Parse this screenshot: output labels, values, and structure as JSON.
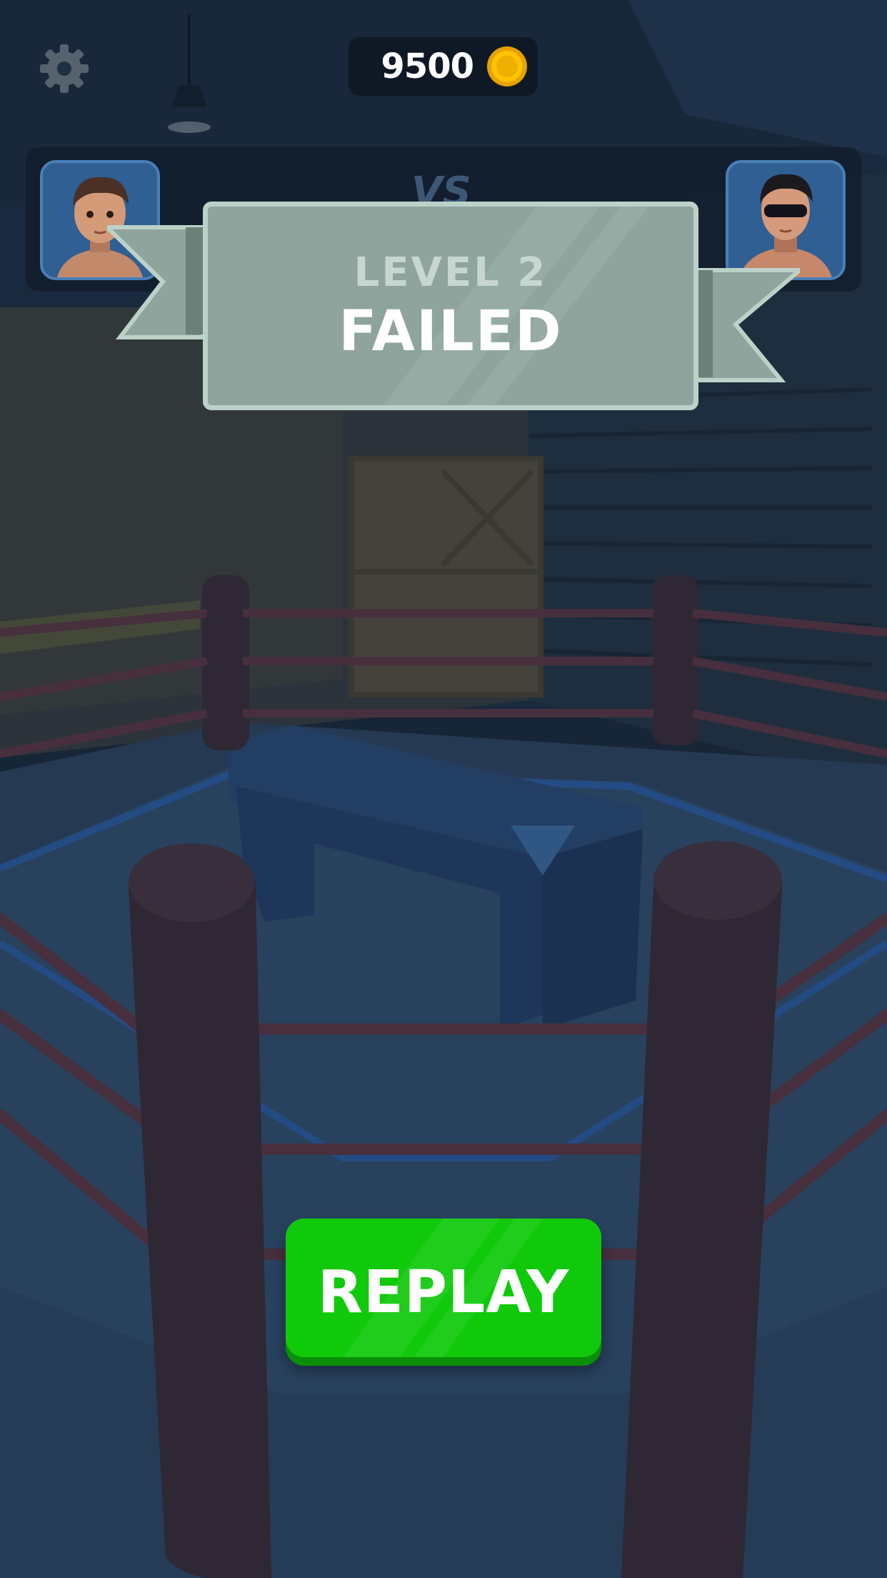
{
  "hud": {
    "coins": "9500",
    "settings_icon": "gear-icon",
    "coin_icon": "gold-coin-icon"
  },
  "versus": {
    "vs_label": "VS",
    "player_avatar": "player-boxer-portrait",
    "opponent_avatar": "opponent-boxer-sunglasses-portrait"
  },
  "result_banner": {
    "level_text": "LEVEL 2",
    "status_text": "FAILED"
  },
  "replay": {
    "label": "REPLAY",
    "color": "#10c90b"
  },
  "colors": {
    "banner": "#8ea49c",
    "rope": "#6b3e4a",
    "mat": "#2e4561",
    "bench": "#2b4b78"
  }
}
